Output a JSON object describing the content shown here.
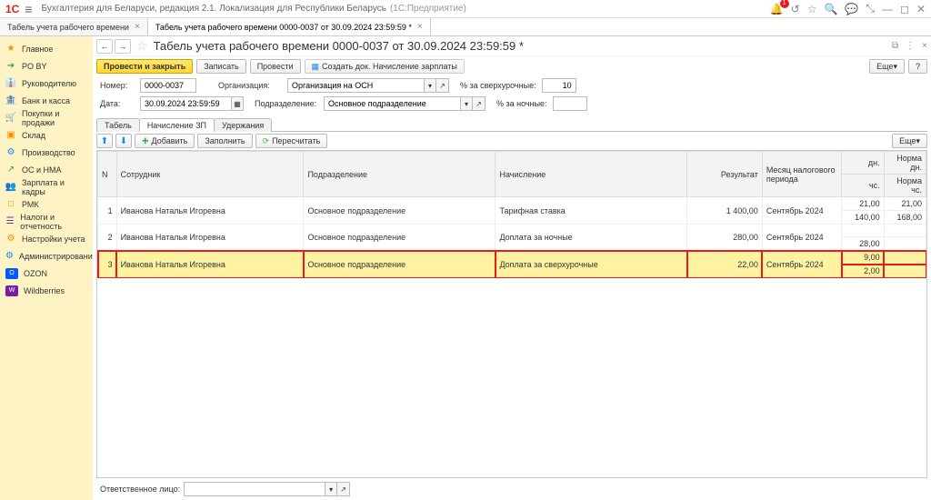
{
  "app": {
    "title": "Бухгалтерия для Беларуси, редакция 2.1. Локализация для Республики Беларусь",
    "subtitle": "(1С:Предприятие)",
    "bell_count": "1"
  },
  "tabs": [
    {
      "label": "Табель учета рабочего времени"
    },
    {
      "label": "Табель учета рабочего времени 0000-0037 от 30.09.2024 23:59:59 *"
    }
  ],
  "sidebar": [
    {
      "icon": "★",
      "cls": "c3",
      "label": "Главное"
    },
    {
      "icon": "➔",
      "cls": "c4",
      "label": "PO BY"
    },
    {
      "icon": "👔",
      "cls": "c2",
      "label": "Руководителю"
    },
    {
      "icon": "🏦",
      "cls": "c4",
      "label": "Банк и касса"
    },
    {
      "icon": "🛒",
      "cls": "c5",
      "label": "Покупки и продажи"
    },
    {
      "icon": "▣",
      "cls": "c3",
      "label": "Склад"
    },
    {
      "icon": "⚙",
      "cls": "c1",
      "label": "Производство"
    },
    {
      "icon": "↗",
      "cls": "c4",
      "label": "ОС и НМА"
    },
    {
      "icon": "👥",
      "cls": "c6",
      "label": "Зарплата и кадры"
    },
    {
      "icon": "□",
      "cls": "c3",
      "label": "РМК"
    },
    {
      "icon": "☰",
      "cls": "c2",
      "label": "Налоги и отчетность"
    },
    {
      "icon": "⚙",
      "cls": "c3",
      "label": "Настройки учета"
    },
    {
      "icon": "⚙",
      "cls": "c1",
      "label": "Администрирование"
    },
    {
      "icon": "O",
      "cls": "ozon",
      "label": "OZON"
    },
    {
      "icon": "W",
      "cls": "wb",
      "label": "Wildberries"
    }
  ],
  "doc": {
    "title": "Табель учета рабочего времени 0000-0037 от 30.09.2024 23:59:59 *"
  },
  "cmd": {
    "post_close": "Провести и закрыть",
    "write": "Записать",
    "post": "Провести",
    "create_doc": "Создать док. Начисление зарплаты",
    "more": "Еще",
    "help": "?"
  },
  "form": {
    "number_lbl": "Номер:",
    "number": "0000-0037",
    "org_lbl": "Организация:",
    "org": "Организация на ОСН",
    "over_lbl": "% за сверхурочные:",
    "over": "10",
    "date_lbl": "Дата:",
    "date": "30.09.2024 23:59:59",
    "dept_lbl": "Подразделение:",
    "dept": "Основное подразделение",
    "night_lbl": "% за ночные:",
    "night": ""
  },
  "subtabs": {
    "t1": "Табель",
    "t2": "Начисление ЗП",
    "t3": "Удержания"
  },
  "tblbar": {
    "add": "Добавить",
    "fill": "Заполнить",
    "recalc": "Пересчитать",
    "more": "Еще"
  },
  "columns": {
    "n": "N",
    "emp": "Сотрудник",
    "dept": "Подразделение",
    "accr": "Начисление",
    "result": "Результат",
    "period": "Месяц налогового периода",
    "dn": "дн.",
    "norm_dn": "Норма дн.",
    "chs": "чс.",
    "norm_chs": "Норма чс."
  },
  "rows": [
    {
      "n": "1",
      "emp": "Иванова Наталья Игоревна",
      "dept": "Основное подразделение",
      "accr": "Тарифная ставка",
      "result": "1 400,00",
      "period": "Сентябрь 2024",
      "dn": "21,00",
      "norm_dn": "21,00",
      "chs": "140,00",
      "norm_chs": "168,00"
    },
    {
      "n": "2",
      "emp": "Иванова Наталья Игоревна",
      "dept": "Основное подразделение",
      "accr": "Доплата за ночные",
      "result": "280,00",
      "period": "Сентябрь 2024",
      "dn": "",
      "norm_dn": "",
      "chs": "28,00",
      "norm_chs": ""
    },
    {
      "n": "3",
      "emp": "Иванова Наталья Игоревна",
      "dept": "Основное подразделение",
      "accr": "Доплата за сверхурочные",
      "result": "22,00",
      "period": "Сентябрь 2024",
      "dn": "9,00",
      "norm_dn": "",
      "chs": "2,00",
      "norm_chs": ""
    }
  ],
  "bottom": {
    "label": "Ответственное лицо:"
  }
}
